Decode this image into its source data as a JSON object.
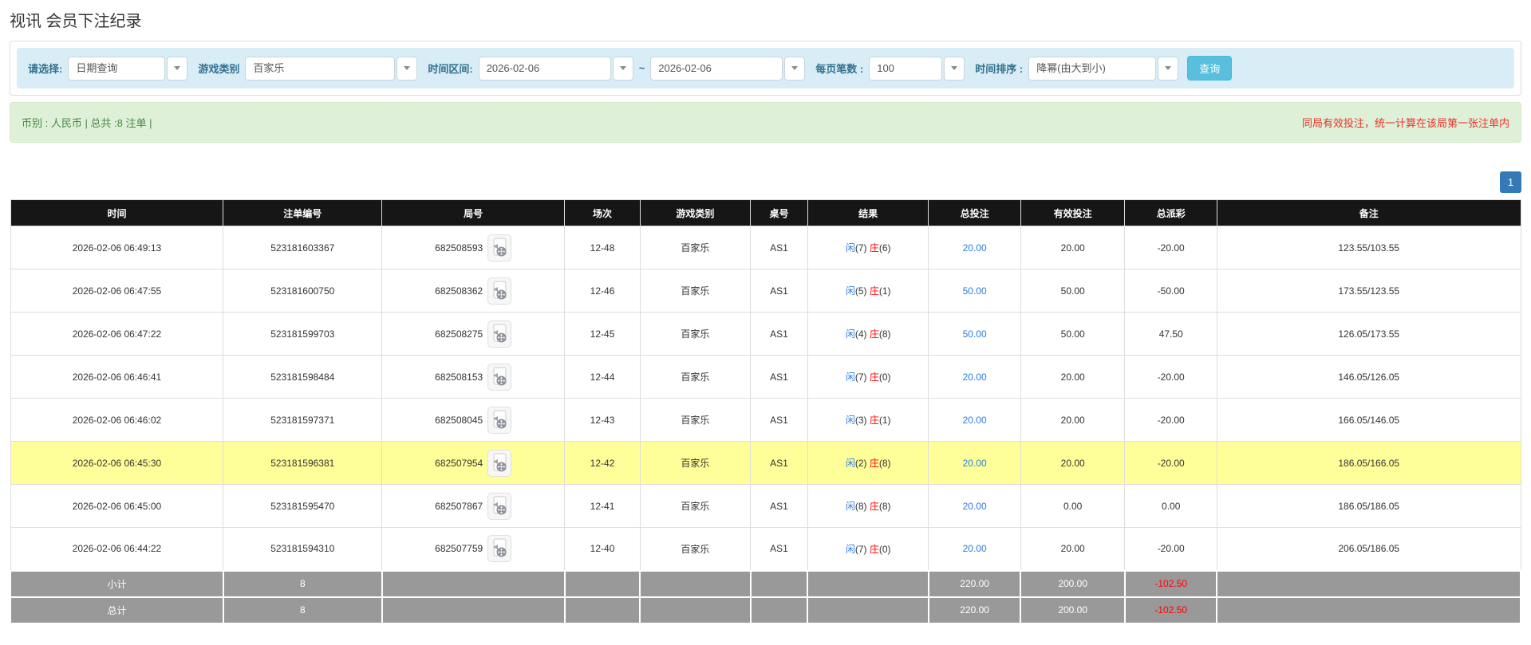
{
  "page": {
    "title": "视讯 会员下注纪录"
  },
  "filters": {
    "select_label": "请选择:",
    "select_value": "日期查询",
    "game_type_label": "游戏类别",
    "game_type_value": "百家乐",
    "time_range_label": "时间区间:",
    "date_from": "2026-02-06",
    "tilde": "~",
    "date_to": "2026-02-06",
    "per_page_label": "每页笔数 :",
    "per_page_value": "100",
    "sort_label": "时间排序 :",
    "sort_value": "降幂(由大到小)",
    "search_button_label": "查询"
  },
  "summary": {
    "left_text": "币别 : 人民币 | 总共 :8 注单 |",
    "right_note": "同局有效投注，统一计算在该局第一张注单内"
  },
  "pagination": {
    "current_page": "1"
  },
  "icons": {
    "video_icon": "video-record-icon",
    "dropdown_icon": "chevron-down-icon"
  },
  "colors": {
    "filter_bar_bg": "#d9edf7",
    "filter_label": "#31708f",
    "summary_bg": "#dff0d8",
    "summary_text": "#468847",
    "note_red": "#e9322d",
    "search_button_bg": "#58c0dc",
    "pagination_bg": "#337ab7",
    "header_bg": "#161616",
    "footer_bg": "#999999",
    "highlight_yellow": "#ffff99",
    "accent_blue": "#2b7de1",
    "negative_red": "#ff0000"
  },
  "table": {
    "columns": [
      "时间",
      "注单编号",
      "局号",
      "场次",
      "游戏类别",
      "桌号",
      "结果",
      "总投注",
      "有效投注",
      "总派彩",
      "备注"
    ],
    "rows": [
      {
        "time": "2026-02-06 06:49:13",
        "bet_id": "523181603367",
        "round_id": "682508593",
        "session": "12-48",
        "game": "百家乐",
        "table_no": "AS1",
        "result": {
          "p": "闲",
          "pn": "(7)",
          "b": "庄",
          "bn": "(6)"
        },
        "total_bet": "20.00",
        "valid_bet": "20.00",
        "payout": "-20.00",
        "remark": "123.55/103.55",
        "highlighted": false
      },
      {
        "time": "2026-02-06 06:47:55",
        "bet_id": "523181600750",
        "round_id": "682508362",
        "session": "12-46",
        "game": "百家乐",
        "table_no": "AS1",
        "result": {
          "p": "闲",
          "pn": "(5)",
          "b": "庄",
          "bn": "(1)"
        },
        "total_bet": "50.00",
        "valid_bet": "50.00",
        "payout": "-50.00",
        "remark": "173.55/123.55",
        "highlighted": false
      },
      {
        "time": "2026-02-06 06:47:22",
        "bet_id": "523181599703",
        "round_id": "682508275",
        "session": "12-45",
        "game": "百家乐",
        "table_no": "AS1",
        "result": {
          "p": "闲",
          "pn": "(4)",
          "b": "庄",
          "bn": "(8)"
        },
        "total_bet": "50.00",
        "valid_bet": "50.00",
        "payout": "47.50",
        "remark": "126.05/173.55",
        "highlighted": false
      },
      {
        "time": "2026-02-06 06:46:41",
        "bet_id": "523181598484",
        "round_id": "682508153",
        "session": "12-44",
        "game": "百家乐",
        "table_no": "AS1",
        "result": {
          "p": "闲",
          "pn": "(7)",
          "b": "庄",
          "bn": "(0)"
        },
        "total_bet": "20.00",
        "valid_bet": "20.00",
        "payout": "-20.00",
        "remark": "146.05/126.05",
        "highlighted": false
      },
      {
        "time": "2026-02-06 06:46:02",
        "bet_id": "523181597371",
        "round_id": "682508045",
        "session": "12-43",
        "game": "百家乐",
        "table_no": "AS1",
        "result": {
          "p": "闲",
          "pn": "(3)",
          "b": "庄",
          "bn": "(1)"
        },
        "total_bet": "20.00",
        "valid_bet": "20.00",
        "payout": "-20.00",
        "remark": "166.05/146.05",
        "highlighted": false
      },
      {
        "time": "2026-02-06 06:45:30",
        "bet_id": "523181596381",
        "round_id": "682507954",
        "session": "12-42",
        "game": "百家乐",
        "table_no": "AS1",
        "result": {
          "p": "闲",
          "pn": "(2)",
          "b": "庄",
          "bn": "(8)"
        },
        "total_bet": "20.00",
        "valid_bet": "20.00",
        "payout": "-20.00",
        "remark": "186.05/166.05",
        "highlighted": true
      },
      {
        "time": "2026-02-06 06:45:00",
        "bet_id": "523181595470",
        "round_id": "682507867",
        "session": "12-41",
        "game": "百家乐",
        "table_no": "AS1",
        "result": {
          "p": "闲",
          "pn": "(8)",
          "b": "庄",
          "bn": "(8)"
        },
        "total_bet": "20.00",
        "valid_bet": "0.00",
        "payout": "0.00",
        "remark": "186.05/186.05",
        "highlighted": false
      },
      {
        "time": "2026-02-06 06:44:22",
        "bet_id": "523181594310",
        "round_id": "682507759",
        "session": "12-40",
        "game": "百家乐",
        "table_no": "AS1",
        "result": {
          "p": "闲",
          "pn": "(7)",
          "b": "庄",
          "bn": "(0)"
        },
        "total_bet": "20.00",
        "valid_bet": "20.00",
        "payout": "-20.00",
        "remark": "206.05/186.05",
        "highlighted": false
      }
    ],
    "footer": [
      {
        "label": "小计",
        "count": "8",
        "total_bet": "220.00",
        "valid_bet": "200.00",
        "payout": "-102.50"
      },
      {
        "label": "总计",
        "count": "8",
        "total_bet": "220.00",
        "valid_bet": "200.00",
        "payout": "-102.50"
      }
    ]
  }
}
